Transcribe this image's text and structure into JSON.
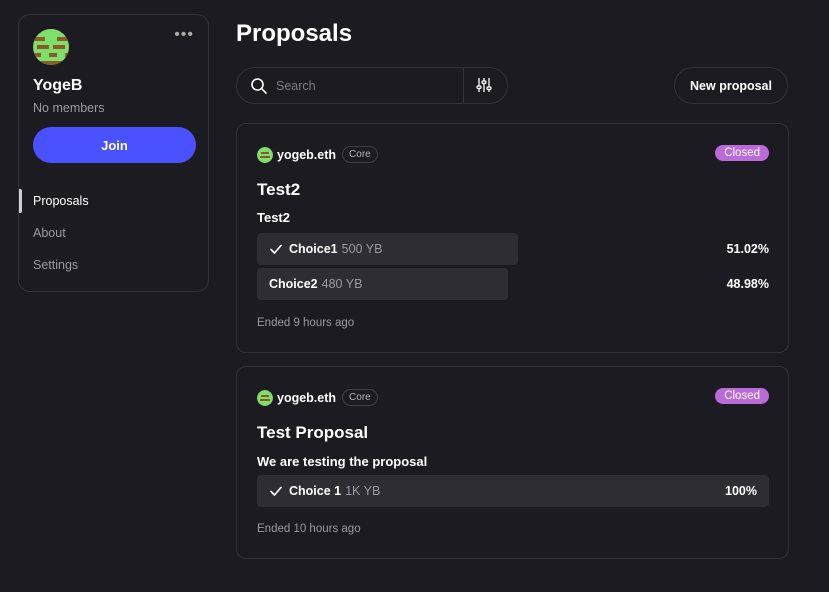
{
  "space": {
    "name": "YogeB",
    "members": "No members",
    "join_label": "Join",
    "more_icon": "more-horizontal-icon"
  },
  "nav": {
    "items": [
      {
        "label": "Proposals",
        "active": true
      },
      {
        "label": "About",
        "active": false
      },
      {
        "label": "Settings",
        "active": false
      }
    ]
  },
  "page_title": "Proposals",
  "search": {
    "placeholder": "Search",
    "value": ""
  },
  "new_proposal_label": "New proposal",
  "proposals": [
    {
      "author": "yogeb.eth",
      "badge": "Core",
      "status": "Closed",
      "title": "Test2",
      "body": "Test2",
      "choices": [
        {
          "label": "Choice1",
          "score": "500 YB",
          "percent": "51.02%",
          "fraction": 0.5102,
          "selected": true
        },
        {
          "label": "Choice2",
          "score": "480 YB",
          "percent": "48.98%",
          "fraction": 0.4898,
          "selected": false
        }
      ],
      "ended": "Ended 9 hours ago"
    },
    {
      "author": "yogeb.eth",
      "badge": "Core",
      "status": "Closed",
      "title": "Test Proposal",
      "body": "We are testing the proposal",
      "choices": [
        {
          "label": "Choice 1",
          "score": "1K YB",
          "percent": "100%",
          "fraction": 1.0,
          "selected": true
        }
      ],
      "ended": "Ended 10 hours ago"
    }
  ],
  "colors": {
    "background": "#1c1b22",
    "border": "#34333a",
    "accent": "#4a52ff",
    "closed_badge": "#bb6bd9",
    "choice_bar": "#2e2d33"
  }
}
